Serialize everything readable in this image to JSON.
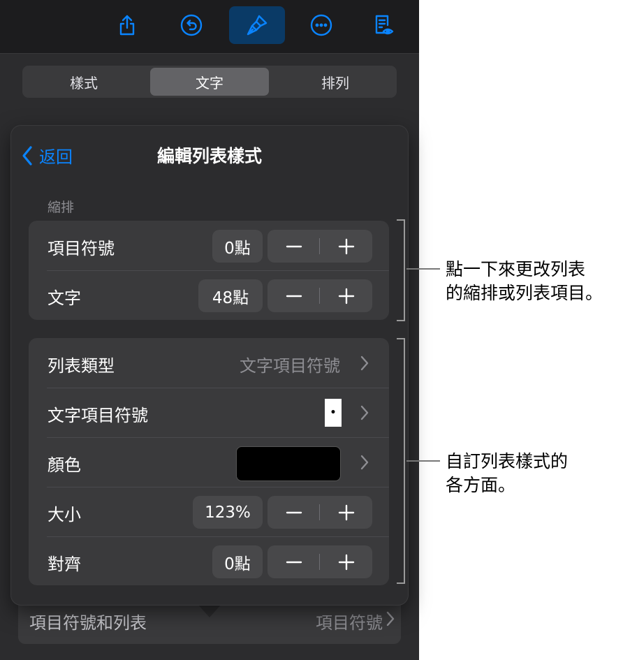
{
  "toolbar": {
    "icons": [
      "share-icon",
      "undo-icon",
      "paintbrush-icon",
      "more-icon",
      "reader-view-icon"
    ],
    "active_color": "#0a3a66",
    "icon_color": "#0a84ff"
  },
  "segments": {
    "items": [
      "樣式",
      "文字",
      "排列"
    ],
    "selected": "文字"
  },
  "underlying": {
    "label": "項目符號和列表",
    "value": "項目符號"
  },
  "popover": {
    "back_label": "返回",
    "title": "編輯列表樣式",
    "indent_section": "縮排",
    "indent_rows": [
      {
        "label": "項目符號",
        "value": "0點"
      },
      {
        "label": "文字",
        "value": "48點"
      }
    ],
    "style_rows": {
      "list_type": {
        "label": "列表類型",
        "value": "文字項目符號"
      },
      "text_bullet": {
        "label": "文字項目符號",
        "value": "•"
      },
      "color": {
        "label": "顏色",
        "value": "#000000"
      },
      "size": {
        "label": "大小",
        "value": "123%"
      },
      "align": {
        "label": "對齊",
        "value": "0點"
      }
    },
    "accent": "#0a84ff"
  },
  "callouts": {
    "first": [
      "點一下來更改列表",
      "的縮排或列表項目。"
    ],
    "second": [
      "自訂列表樣式的",
      "各方面。"
    ]
  }
}
